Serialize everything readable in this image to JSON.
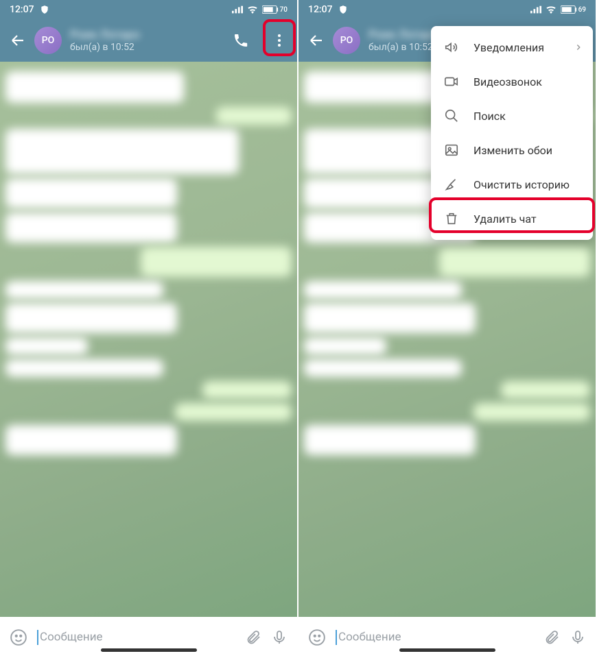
{
  "statusbar": {
    "time": "12:07",
    "battery_left": "70",
    "battery_right": "69"
  },
  "header": {
    "avatar_initials": "PO",
    "name": "Роик Лотаро",
    "status": "был(а) в 10:52"
  },
  "dropdown": {
    "notifications": "Уведомления",
    "videocall": "Видеозвонок",
    "search": "Поиск",
    "wallpaper": "Изменить обои",
    "clear_history": "Очистить историю",
    "delete_chat": "Удалить чат"
  },
  "input": {
    "placeholder": "Сообщение"
  }
}
